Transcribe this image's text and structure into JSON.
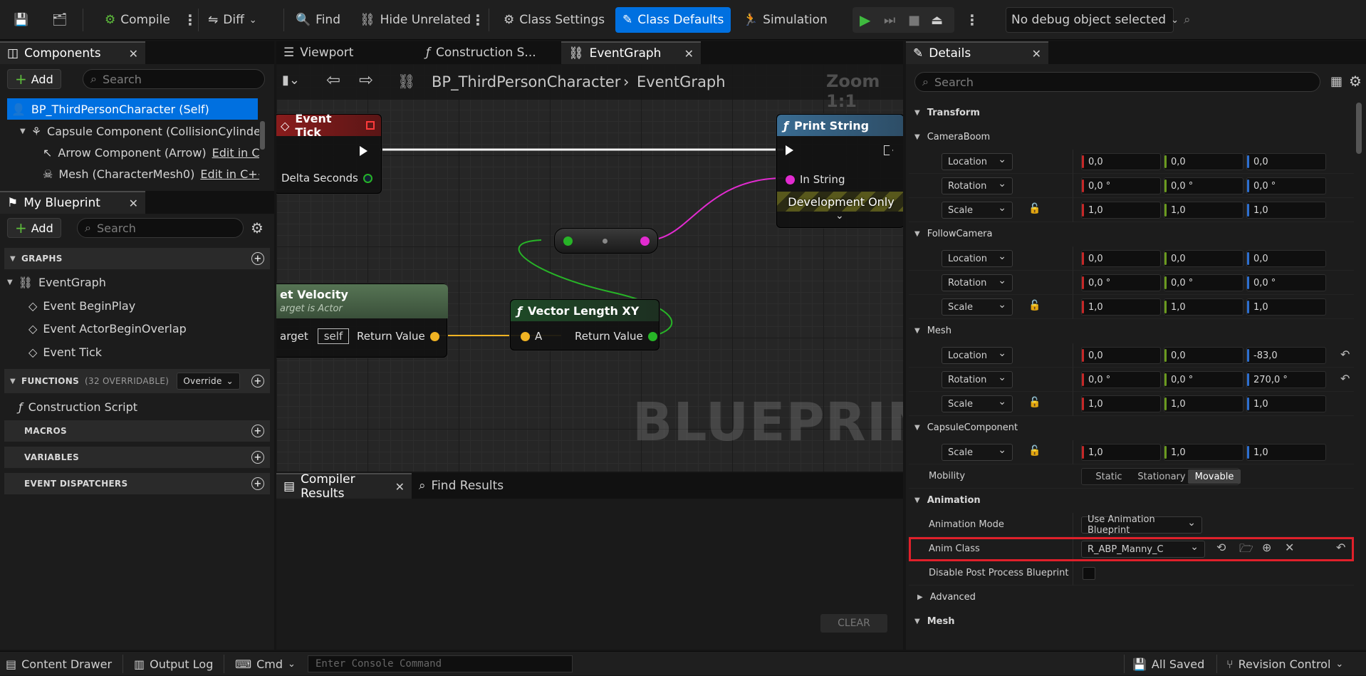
{
  "toolbar": {
    "compile": "Compile",
    "diff": "Diff",
    "find": "Find",
    "hide_unrelated": "Hide Unrelated",
    "class_settings": "Class Settings",
    "class_defaults": "Class Defaults",
    "simulation": "Simulation",
    "debug_object": "No debug object selected"
  },
  "components": {
    "title": "Components",
    "add": "Add",
    "search_placeholder": "Search",
    "items": [
      {
        "label": "BP_ThirdPersonCharacter (Self)",
        "link": ""
      },
      {
        "label": "Capsule Component (CollisionCylinde",
        "link": ""
      },
      {
        "label": "Arrow Component (Arrow)",
        "link": "Edit in C"
      },
      {
        "label": "Mesh (CharacterMesh0)",
        "link": "Edit in C++"
      }
    ]
  },
  "my_blueprint": {
    "title": "My Blueprint",
    "add": "Add",
    "search_placeholder": "Search",
    "graphs": "GRAPHS",
    "graph_items": [
      "EventGraph",
      "Event BeginPlay",
      "Event ActorBeginOverlap",
      "Event Tick"
    ],
    "functions": "FUNCTIONS",
    "functions_count": "(32 OVERRIDABLE)",
    "override": "Override",
    "function_items": [
      "Construction Script"
    ],
    "macros": "MACROS",
    "variables": "VARIABLES",
    "event_dispatchers": "EVENT DISPATCHERS"
  },
  "editor": {
    "tabs": [
      "Viewport",
      "Construction S...",
      "EventGraph"
    ],
    "breadcrumb_root": "BP_ThirdPersonCharacter",
    "breadcrumb_current": "EventGraph",
    "zoom": "Zoom 1:1",
    "watermark": "BLUEPRINT"
  },
  "nodes": {
    "event_tick": {
      "title": "Event Tick",
      "pin": "Delta Seconds"
    },
    "print_string": {
      "title": "Print String",
      "pin": "In String",
      "dev": "Development Only"
    },
    "get_velocity": {
      "title": "et Velocity",
      "subtitle": "arget is Actor",
      "target_label": "arget",
      "target_value": "self",
      "return": "Return Value"
    },
    "vector_length": {
      "title": "Vector Length XY",
      "pin_a": "A",
      "return": "Return Value"
    }
  },
  "results": {
    "tabs": [
      "Compiler Results",
      "Find Results"
    ],
    "clear": "CLEAR"
  },
  "details": {
    "title": "Details",
    "search_placeholder": "Search",
    "transform": "Transform",
    "groups": [
      {
        "name": "CameraBoom",
        "rows": [
          {
            "label": "Location",
            "x": "0,0",
            "y": "0,0",
            "z": "0,0"
          },
          {
            "label": "Rotation",
            "x": "0,0 °",
            "y": "0,0 °",
            "z": "0,0 °"
          },
          {
            "label": "Scale",
            "x": "1,0",
            "y": "1,0",
            "z": "1,0"
          }
        ]
      },
      {
        "name": "FollowCamera",
        "rows": [
          {
            "label": "Location",
            "x": "0,0",
            "y": "0,0",
            "z": "0,0"
          },
          {
            "label": "Rotation",
            "x": "0,0 °",
            "y": "0,0 °",
            "z": "0,0 °"
          },
          {
            "label": "Scale",
            "x": "1,0",
            "y": "1,0",
            "z": "1,0"
          }
        ]
      },
      {
        "name": "Mesh",
        "rows": [
          {
            "label": "Location",
            "x": "0,0",
            "y": "0,0",
            "z": "-83,0"
          },
          {
            "label": "Rotation",
            "x": "0,0 °",
            "y": "0,0 °",
            "z": "270,0 °"
          },
          {
            "label": "Scale",
            "x": "1,0",
            "y": "1,0",
            "z": "1,0"
          }
        ]
      },
      {
        "name": "CapsuleComponent",
        "rows": [
          {
            "label": "Scale",
            "x": "1,0",
            "y": "1,0",
            "z": "1,0"
          }
        ]
      }
    ],
    "mobility_label": "Mobility",
    "mobility_options": [
      "Static",
      "Stationary",
      "Movable"
    ],
    "mobility_selected": "Movable",
    "animation": "Animation",
    "anim_mode_label": "Animation Mode",
    "anim_mode_value": "Use Animation Blueprint",
    "anim_class_label": "Anim Class",
    "anim_class_value": "R_ABP_Manny_C",
    "disable_ppb_label": "Disable Post Process Blueprint",
    "advanced": "Advanced",
    "mesh_section": "Mesh"
  },
  "statusbar": {
    "content_drawer": "Content Drawer",
    "output_log": "Output Log",
    "cmd": "Cmd",
    "console_placeholder": "Enter Console Command",
    "all_saved": "All Saved",
    "revision_control": "Revision Control"
  },
  "colors": {
    "accent": "#0070e0",
    "highlight_border": "#e0202a",
    "x_axis": "#c62828",
    "y_axis": "#6a9a1f",
    "z_axis": "#2d6fd0"
  }
}
